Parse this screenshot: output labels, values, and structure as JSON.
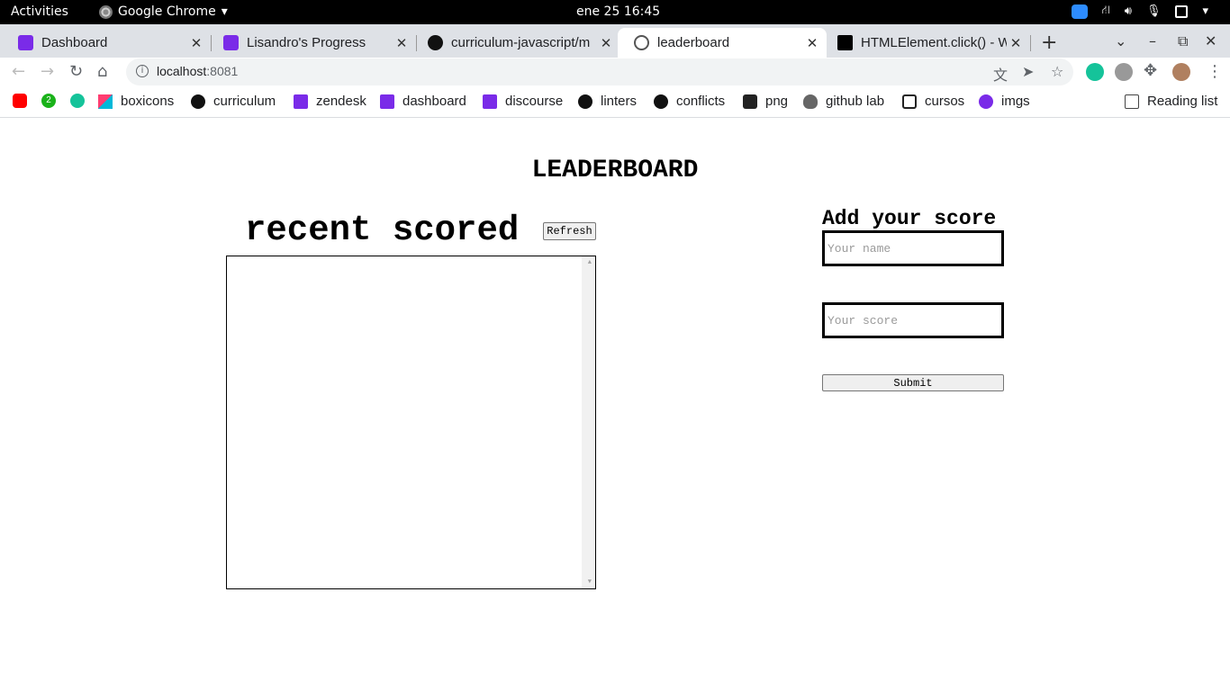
{
  "system_bar": {
    "activities": "Activities",
    "app_name": "Google Chrome",
    "clock": "ene 25  16:45"
  },
  "tabs": [
    {
      "title": "Dashboard",
      "icon": "microverse-icon"
    },
    {
      "title": "Lisandro's Progress",
      "icon": "microverse-icon"
    },
    {
      "title": "curriculum-javascript/m",
      "icon": "github-icon"
    },
    {
      "title": "leaderboard",
      "icon": "globe-icon",
      "active": true
    },
    {
      "title": "HTMLElement.click() - W",
      "icon": "mdn-icon"
    }
  ],
  "address_bar": {
    "host": "localhost",
    "port": ":8081"
  },
  "bookmarks": [
    {
      "label": "",
      "icon": "youtube-icon"
    },
    {
      "label": "",
      "icon": "badge-2-icon",
      "badge": "2"
    },
    {
      "label": "",
      "icon": "grammarly-icon"
    },
    {
      "label": "boxicons",
      "icon": "boxicons-icon"
    },
    {
      "label": "curriculum",
      "icon": "github-icon"
    },
    {
      "label": "zendesk",
      "icon": "microverse-icon"
    },
    {
      "label": "dashboard",
      "icon": "microverse-icon"
    },
    {
      "label": "discourse",
      "icon": "microverse-icon"
    },
    {
      "label": "linters",
      "icon": "github-icon"
    },
    {
      "label": "conflicts",
      "icon": "github-icon"
    },
    {
      "label": "png",
      "icon": "c-icon"
    },
    {
      "label": "github lab",
      "icon": "gitlab-icon"
    },
    {
      "label": "cursos",
      "icon": "terminal-icon"
    },
    {
      "label": "imgs",
      "icon": "search-q-icon"
    }
  ],
  "reading_list": "Reading list",
  "page": {
    "title": "LEADERBOARD",
    "recent_title": "recent scored",
    "refresh_label": "Refresh",
    "add_title": "Add your score",
    "name_placeholder": "Your name",
    "score_placeholder": "Your score",
    "submit_label": "Submit"
  }
}
